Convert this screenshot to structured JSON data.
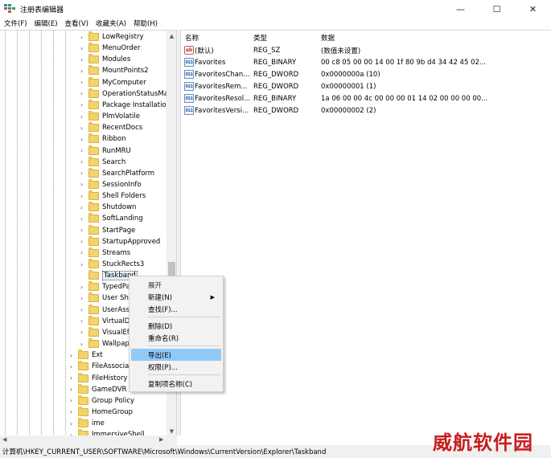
{
  "window": {
    "title": "注册表编辑器",
    "controls": {
      "minimize": "—",
      "maximize": "☐",
      "close": "✕"
    }
  },
  "menu": [
    "文件(F)",
    "编辑(E)",
    "查看(V)",
    "收藏夹(A)",
    "帮助(H)"
  ],
  "tree": {
    "items": [
      {
        "label": "LowRegistry",
        "indent": 1
      },
      {
        "label": "MenuOrder",
        "indent": 1
      },
      {
        "label": "Modules",
        "indent": 1
      },
      {
        "label": "MountPoints2",
        "indent": 1
      },
      {
        "label": "MyComputer",
        "indent": 1
      },
      {
        "label": "OperationStatusMa",
        "indent": 1
      },
      {
        "label": "Package Installation",
        "indent": 1
      },
      {
        "label": "PlmVolatile",
        "indent": 1
      },
      {
        "label": "RecentDocs",
        "indent": 1
      },
      {
        "label": "Ribbon",
        "indent": 1
      },
      {
        "label": "RunMRU",
        "indent": 1
      },
      {
        "label": "Search",
        "indent": 1
      },
      {
        "label": "SearchPlatform",
        "indent": 1
      },
      {
        "label": "SessionInfo",
        "indent": 1
      },
      {
        "label": "Shell Folders",
        "indent": 1
      },
      {
        "label": "Shutdown",
        "indent": 1
      },
      {
        "label": "SoftLanding",
        "indent": 1
      },
      {
        "label": "StartPage",
        "indent": 1
      },
      {
        "label": "StartupApproved",
        "indent": 1
      },
      {
        "label": "Streams",
        "indent": 1
      },
      {
        "label": "StuckRects3",
        "indent": 1
      },
      {
        "label": "Taskband",
        "indent": 1,
        "selected": true
      },
      {
        "label": "TypedPa",
        "indent": 1
      },
      {
        "label": "User Sh",
        "indent": 1
      },
      {
        "label": "UserAss",
        "indent": 1
      },
      {
        "label": "VirtualD",
        "indent": 1
      },
      {
        "label": "VisualEf",
        "indent": 1
      },
      {
        "label": "Wallpap",
        "indent": 1
      },
      {
        "label": "Ext",
        "indent": 0
      },
      {
        "label": "FileAssociat",
        "indent": 0
      },
      {
        "label": "FileHistory",
        "indent": 0
      },
      {
        "label": "GameDVR",
        "indent": 0
      },
      {
        "label": "Group Policy",
        "indent": 0
      },
      {
        "label": "HomeGroup",
        "indent": 0
      },
      {
        "label": "ime",
        "indent": 0
      },
      {
        "label": "ImmersiveShell",
        "indent": 0
      }
    ]
  },
  "list": {
    "headers": {
      "name": "名称",
      "type": "类型",
      "data": "数据"
    },
    "rows": [
      {
        "icon": "string-value-icon",
        "name": "(默认)",
        "type": "REG_SZ",
        "data": "(数值未设置)"
      },
      {
        "icon": "binary-value-icon",
        "name": "Favorites",
        "type": "REG_BINARY",
        "data": "00 c8 05 00 00 14 00 1f 80 9b d4 34 42 45 02..."
      },
      {
        "icon": "binary-value-icon",
        "name": "FavoritesChan...",
        "type": "REG_DWORD",
        "data": "0x0000000a (10)"
      },
      {
        "icon": "binary-value-icon",
        "name": "FavoritesRem...",
        "type": "REG_DWORD",
        "data": "0x00000001 (1)"
      },
      {
        "icon": "binary-value-icon",
        "name": "FavoritesResol...",
        "type": "REG_BINARY",
        "data": "1a 06 00 00 4c 00 00 00 01 14 02 00 00 00 00..."
      },
      {
        "icon": "binary-value-icon",
        "name": "FavoritesVersi...",
        "type": "REG_DWORD",
        "data": "0x00000002 (2)"
      }
    ]
  },
  "context_menu": {
    "items": [
      {
        "label": "展开"
      },
      {
        "label": "新建(N)",
        "submenu": true
      },
      {
        "label": "查找(F)..."
      },
      {
        "label": "删除(D)"
      },
      {
        "label": "重命名(R)"
      },
      {
        "label": "导出(E)",
        "highlighted": true
      },
      {
        "label": "权限(P)..."
      },
      {
        "label": "复制项名称(C)"
      }
    ]
  },
  "status_path": "计算机\\HKEY_CURRENT_USER\\SOFTWARE\\Microsoft\\Windows\\CurrentVersion\\Explorer\\Taskband",
  "watermark": "威航软件园",
  "colors": {
    "menu_highlight": "#91c9f7",
    "folder": "#f2d46b",
    "watermark": "#c81c1c"
  }
}
